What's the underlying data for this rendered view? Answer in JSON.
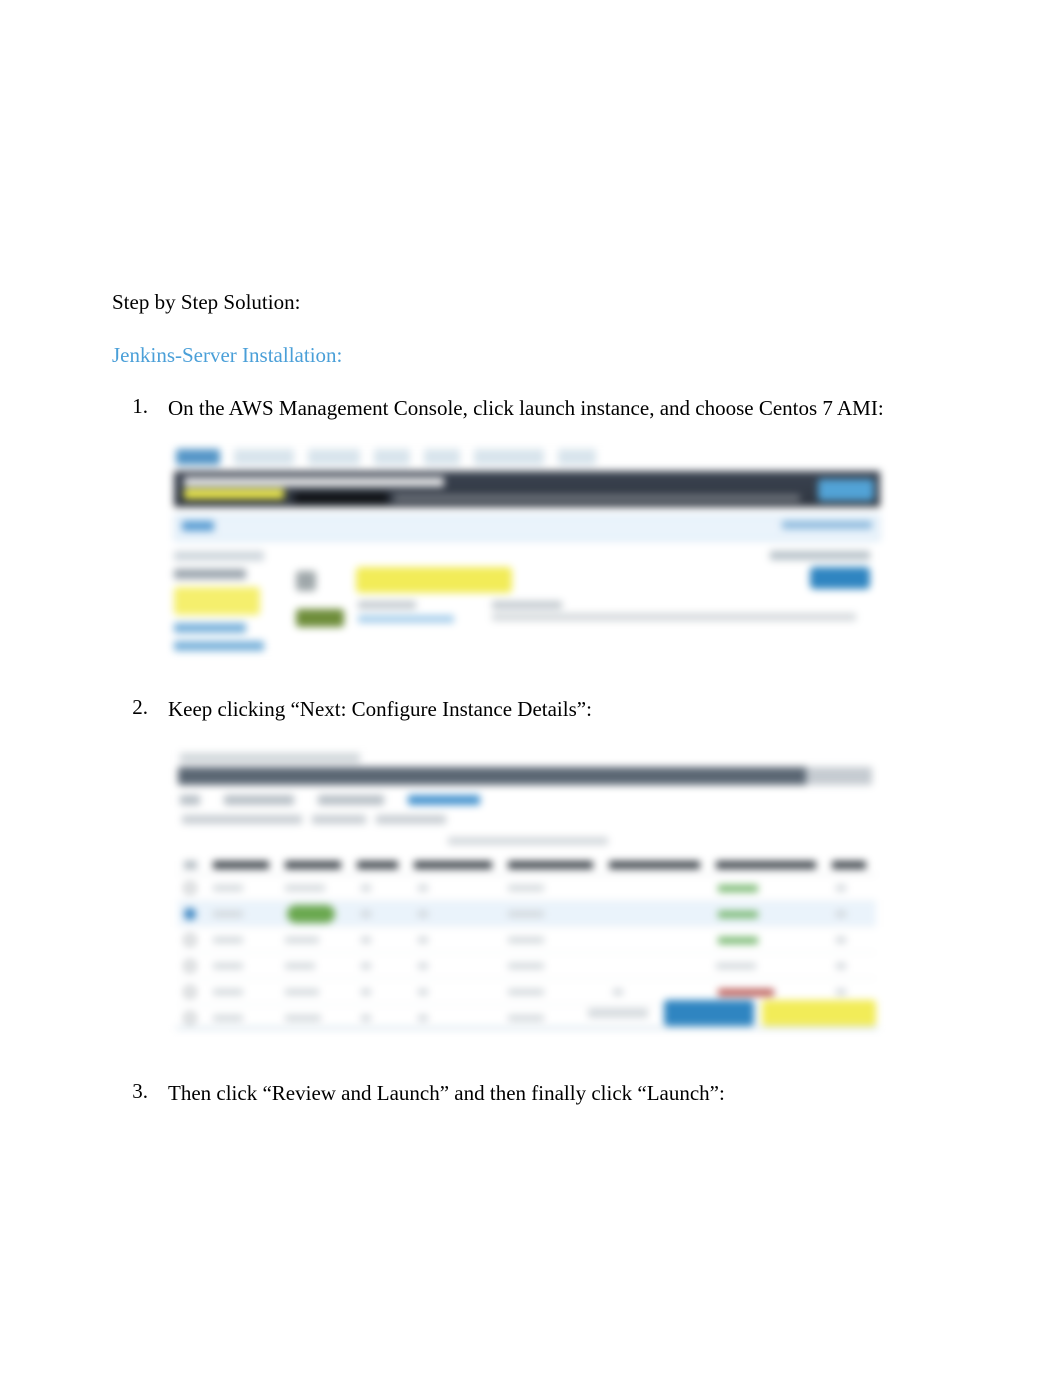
{
  "doc": {
    "heading": "Step by Step Solution:",
    "subheading": "Jenkins-Server Installation:",
    "steps": {
      "1": {
        "num": "1.",
        "text": "On the AWS Management Console, click launch instance, and choose Centos 7 AMI:"
      },
      "2": {
        "num": "2.",
        "text": "Keep clicking “Next: Configure Instance Details”:"
      },
      "3": {
        "num": "3.",
        "text": "Then click “Review and Launch” and then finally click “Launch”:"
      }
    }
  }
}
